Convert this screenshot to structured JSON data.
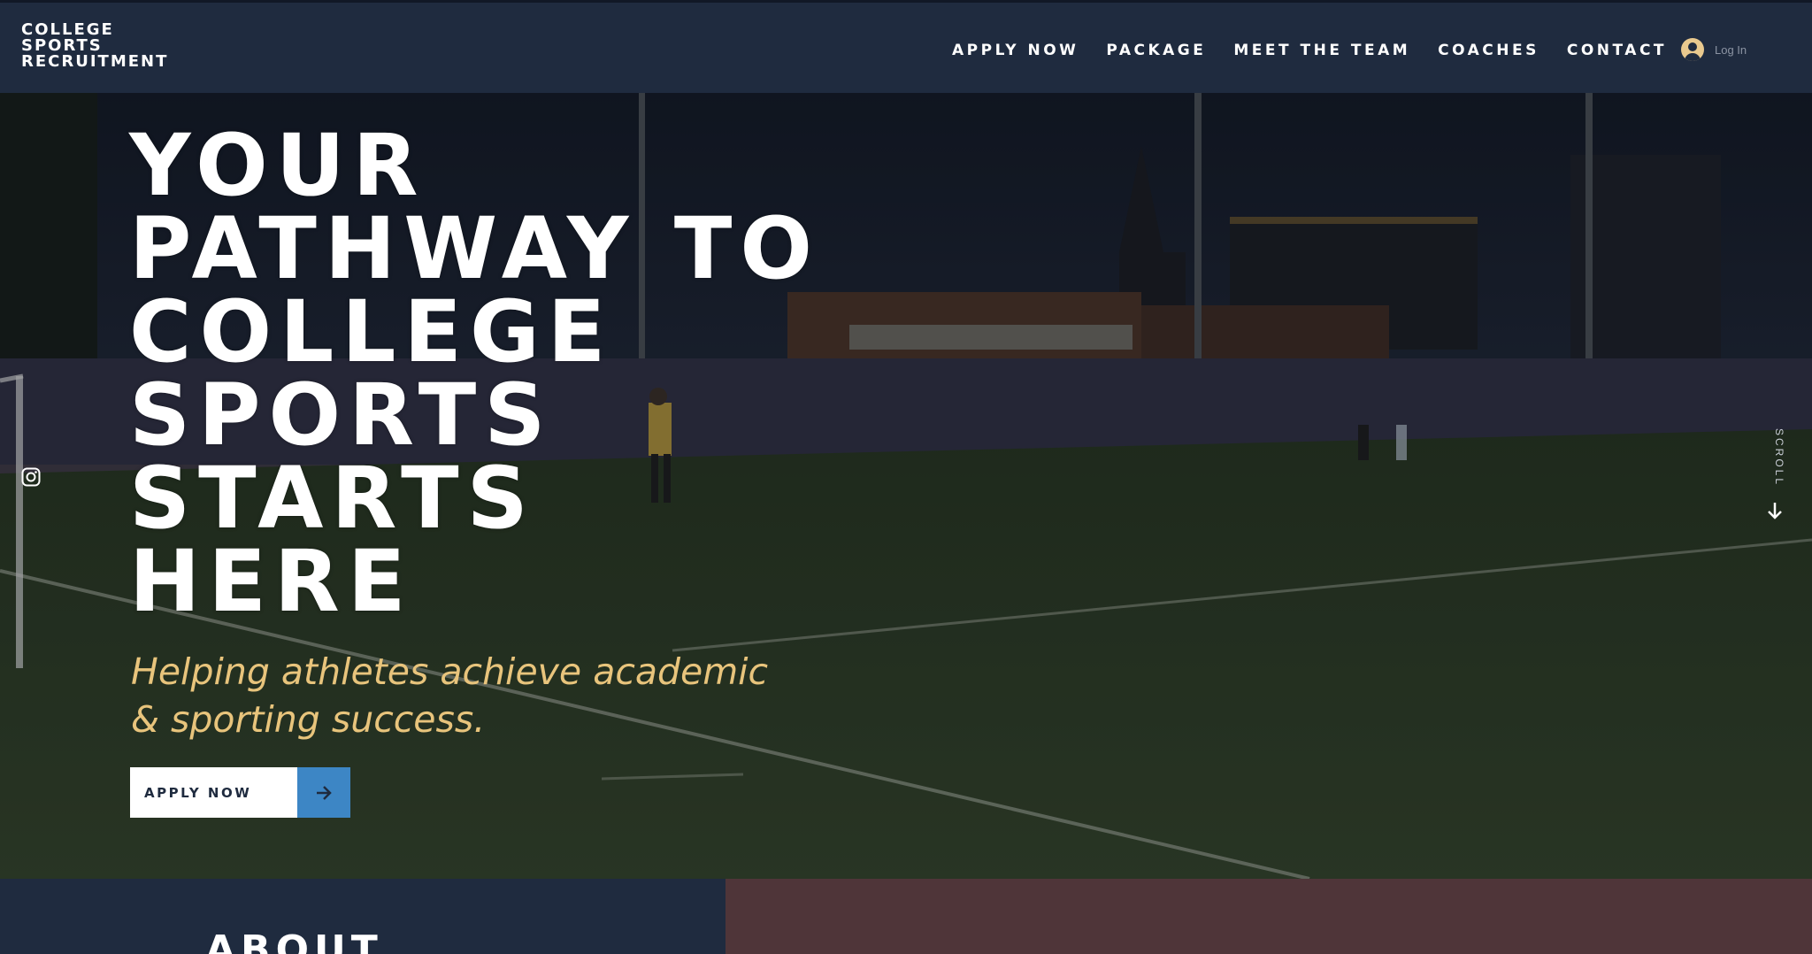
{
  "header": {
    "logo_lines": [
      "COLLEGE",
      "SPORTS",
      "RECRUITMENT"
    ],
    "nav": [
      "APPLY NOW",
      "PACKAGE",
      "MEET THE TEAM",
      "COACHES",
      "CONTACT"
    ],
    "login_label": "Log In"
  },
  "hero": {
    "headline_lines": [
      "YOUR",
      "PATHWAY TO",
      "COLLEGE",
      "SPORTS",
      "STARTS",
      "HERE"
    ],
    "tagline": "Helping athletes achieve academic & sporting success.",
    "cta_label": "APPLY NOW",
    "scroll_label": "SCROLL"
  },
  "about": {
    "title": "ABOUT"
  },
  "colors": {
    "header_bg": "#1f2b3f",
    "tagline": "#e8c47c",
    "cta_arrow_bg": "#3d86c5",
    "maroon_panel": "#4f3539"
  },
  "icons": {
    "social": "instagram-icon",
    "cta": "arrow-right-icon",
    "scroll": "arrow-down-icon",
    "login": "user-avatar-icon"
  }
}
